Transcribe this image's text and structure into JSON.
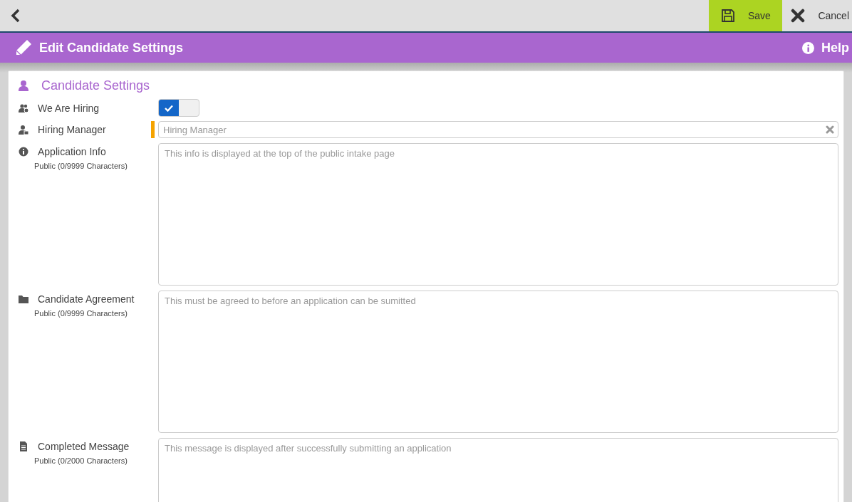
{
  "toolbar": {
    "buttons": [
      {
        "label": "Save",
        "kind": "save",
        "selected": true
      },
      {
        "label": "Cancel",
        "kind": "cancel",
        "selected": false
      }
    ]
  },
  "header": {
    "title": "Edit Candidate Settings",
    "help": "Help"
  },
  "section": {
    "title": "Candidate Settings"
  },
  "fields": [
    {
      "kind": "toggle",
      "label": "We Are Hiring",
      "on": true,
      "required": false
    },
    {
      "kind": "text",
      "label": "Hiring Manager",
      "placeholder": "Hiring Manager",
      "required": true
    },
    {
      "kind": "textarea",
      "label": "Application Info",
      "note": "Public (0/9999 Characters)",
      "placeholder": "This info is displayed at the top of the public intake page",
      "required": false
    },
    {
      "kind": "textarea",
      "label": "Candidate Agreement",
      "note": "Public (0/9999 Characters)",
      "placeholder": "This must be agreed to before an application can be sumitted",
      "required": false
    },
    {
      "kind": "textarea",
      "label": "Completed Message",
      "note": "Public (0/2000 Characters)",
      "placeholder": "This message is displayed after successfully submitting an application",
      "required": false
    }
  ]
}
